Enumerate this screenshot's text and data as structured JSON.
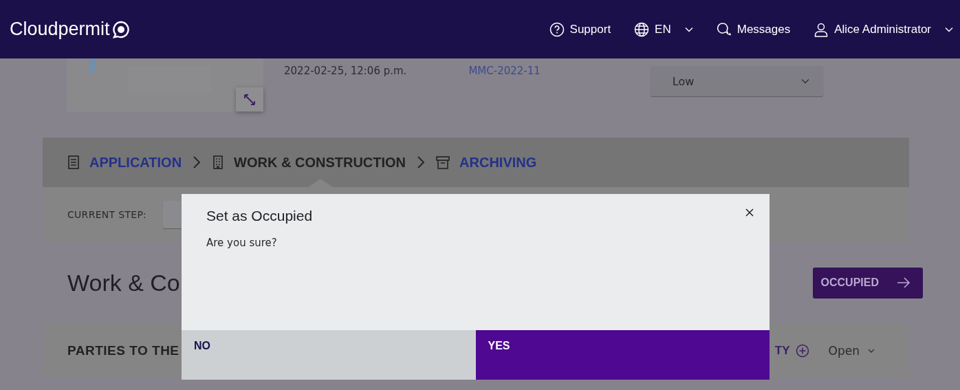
{
  "header": {
    "logo": "Cloudpermit",
    "nav": [
      {
        "kind": "support",
        "label": "Support"
      },
      {
        "kind": "language",
        "label": "EN"
      },
      {
        "kind": "messages",
        "label": "Messages"
      },
      {
        "kind": "user",
        "label": "Alice Administrator"
      }
    ]
  },
  "summary": {
    "date": "2022-02-25, 12:06 p.m.",
    "reference": "MMC-2022-11",
    "priority": "Low"
  },
  "stepper": {
    "steps": [
      {
        "label": "APPLICATION",
        "selected": false
      },
      {
        "label": "WORK & CONSTRUCTION",
        "selected": true
      },
      {
        "label": "ARCHIVING",
        "selected": false
      }
    ],
    "current_step_label": "CURRENT STEP:"
  },
  "section": {
    "title": "Work & Co",
    "action": "OCCUPIED"
  },
  "parties": {
    "title": "PARTIES TO THE",
    "add_label": "TY",
    "toggle": "Open"
  },
  "dialog": {
    "title": "Set as Occupied",
    "message": "Are you sure?",
    "buttons": [
      {
        "kind": "secondary",
        "label": "NO"
      },
      {
        "kind": "primary",
        "label": "YES"
      }
    ]
  }
}
